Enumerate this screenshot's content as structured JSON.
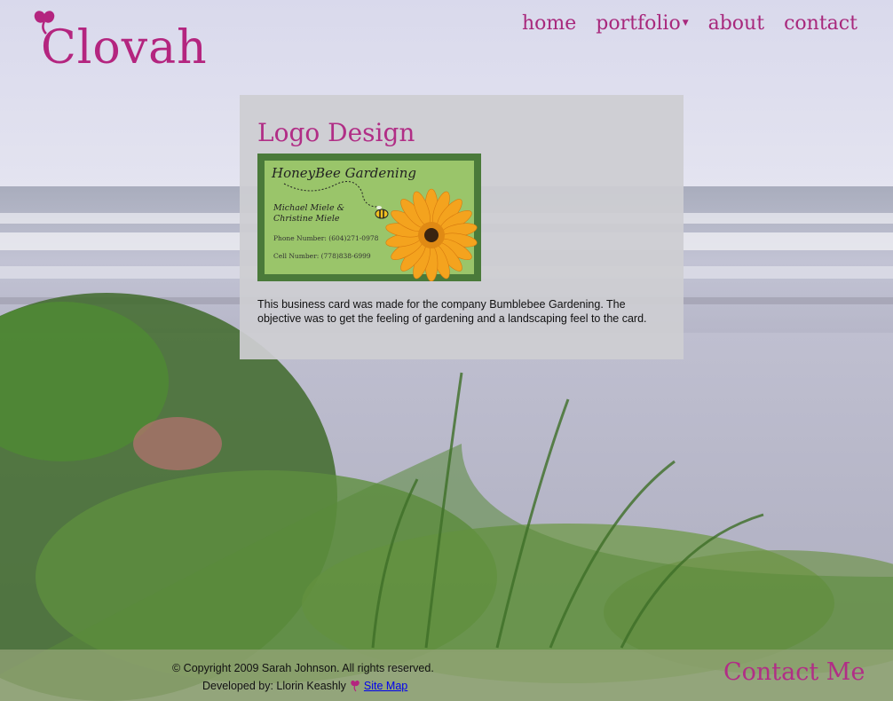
{
  "header": {
    "logo_text": "Clovah",
    "nav": [
      {
        "label": "home"
      },
      {
        "label": "portfolio",
        "has_dropdown": true
      },
      {
        "label": "about"
      },
      {
        "label": "contact"
      }
    ]
  },
  "main": {
    "title": "Logo Design",
    "card": {
      "company": "HoneyBee Gardening",
      "names_line1": "Michael Miele &",
      "names_line2": "Christine Miele",
      "phone": "Phone Number: (604)271-0978",
      "cell": "Cell Number: (778)838-6999"
    },
    "description": "This business card was made for the company Bumblebee Gardening. The objective was to get the feeling of gardening and a landscaping feel to the card."
  },
  "footer": {
    "copyright": "© Copyright 2009 Sarah Johnson. All rights reserved.",
    "developed_by": "Developed by: Llorin Keashly",
    "sitemap_label": "Site Map",
    "contact_label": "Contact Me"
  },
  "colors": {
    "brand": "#b4257f",
    "card_border": "#4a7a3a",
    "card_fill": "#9ac56a",
    "footer": "#96a578"
  }
}
